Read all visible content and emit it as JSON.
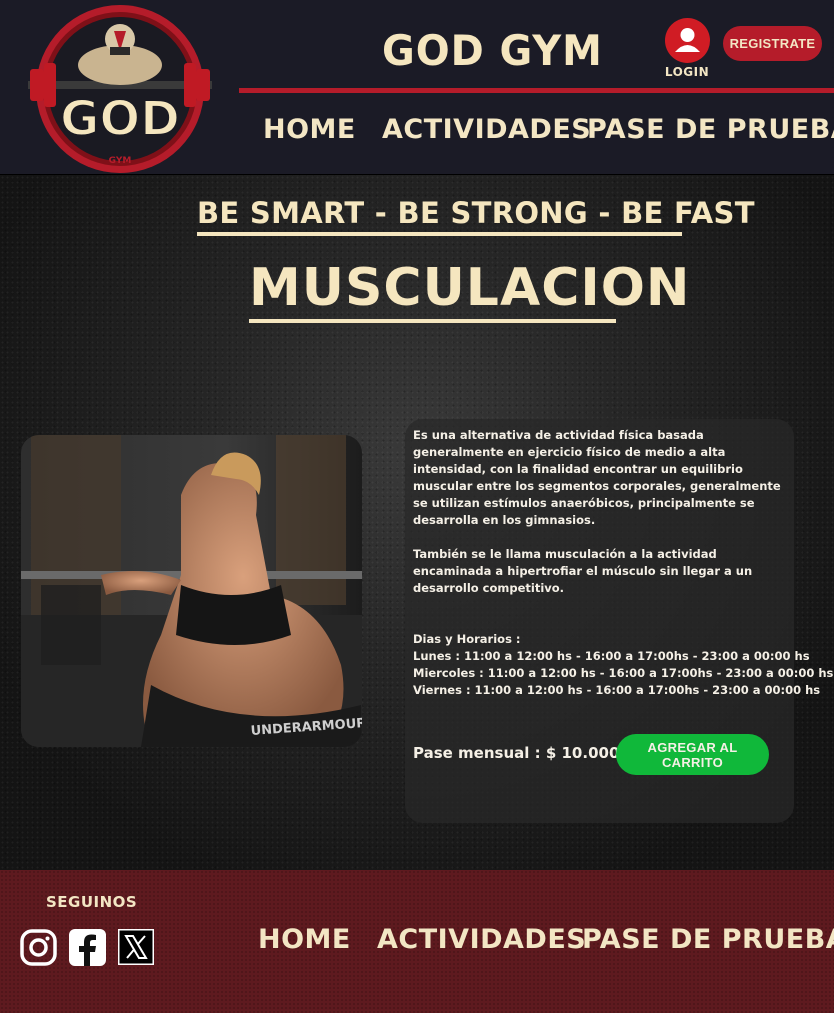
{
  "header": {
    "brand": "GOD GYM",
    "logo_text": "GOD",
    "logo_subtext": "GYM",
    "login_label": "LOGIN",
    "register_label": "REGISTRATE",
    "nav": [
      "HOME",
      "ACTIVIDADES",
      "PASE DE PRUEBA"
    ]
  },
  "main": {
    "slogan": "BE SMART - BE STRONG - BE FAST",
    "title": "MUSCULACION",
    "description_1": "Es una alternativa de actividad física basada generalmente en ejercicio físico de medio a alta intensidad, con la finalidad encontrar un equilibrio muscular entre los segmentos corporales, generalmente se utilizan estímulos anaeróbicos, principalmente se desarrolla en los gimnasios.",
    "description_2": "También se le llama musculación a la actividad encaminada a hipertrofiar el músculo sin llegar a un desarrollo competitivo.",
    "schedule_title": "Dias y Horarios :",
    "schedule": [
      "Lunes : 11:00 a 12:00 hs - 16:00 a 17:00hs - 23:00 a 00:00 hs",
      "Miercoles : 11:00 a 12:00 hs - 16:00 a 17:00hs - 23:00 a 00:00 hs",
      "Viernes :  11:00 a 12:00 hs - 16:00 a 17:00hs - 23:00 a 00:00 hs"
    ],
    "price": "Pase mensual : $ 10.000",
    "cart_label": "AGREGAR AL CARRITO",
    "photo_text": "UNDERARMOUR UNDER"
  },
  "footer": {
    "follow": "SEGUINOS",
    "nav": [
      "HOME",
      "ACTIVIDADES",
      "PASE DE PRUEBA"
    ],
    "social": [
      "instagram-icon",
      "facebook-icon",
      "x-icon"
    ]
  },
  "colors": {
    "accent_red": "#b51c2a",
    "cream": "#f3e6c4",
    "green": "#10b83a",
    "header_bg": "#1b1b26",
    "footer_bg": "#5e1a1f"
  }
}
